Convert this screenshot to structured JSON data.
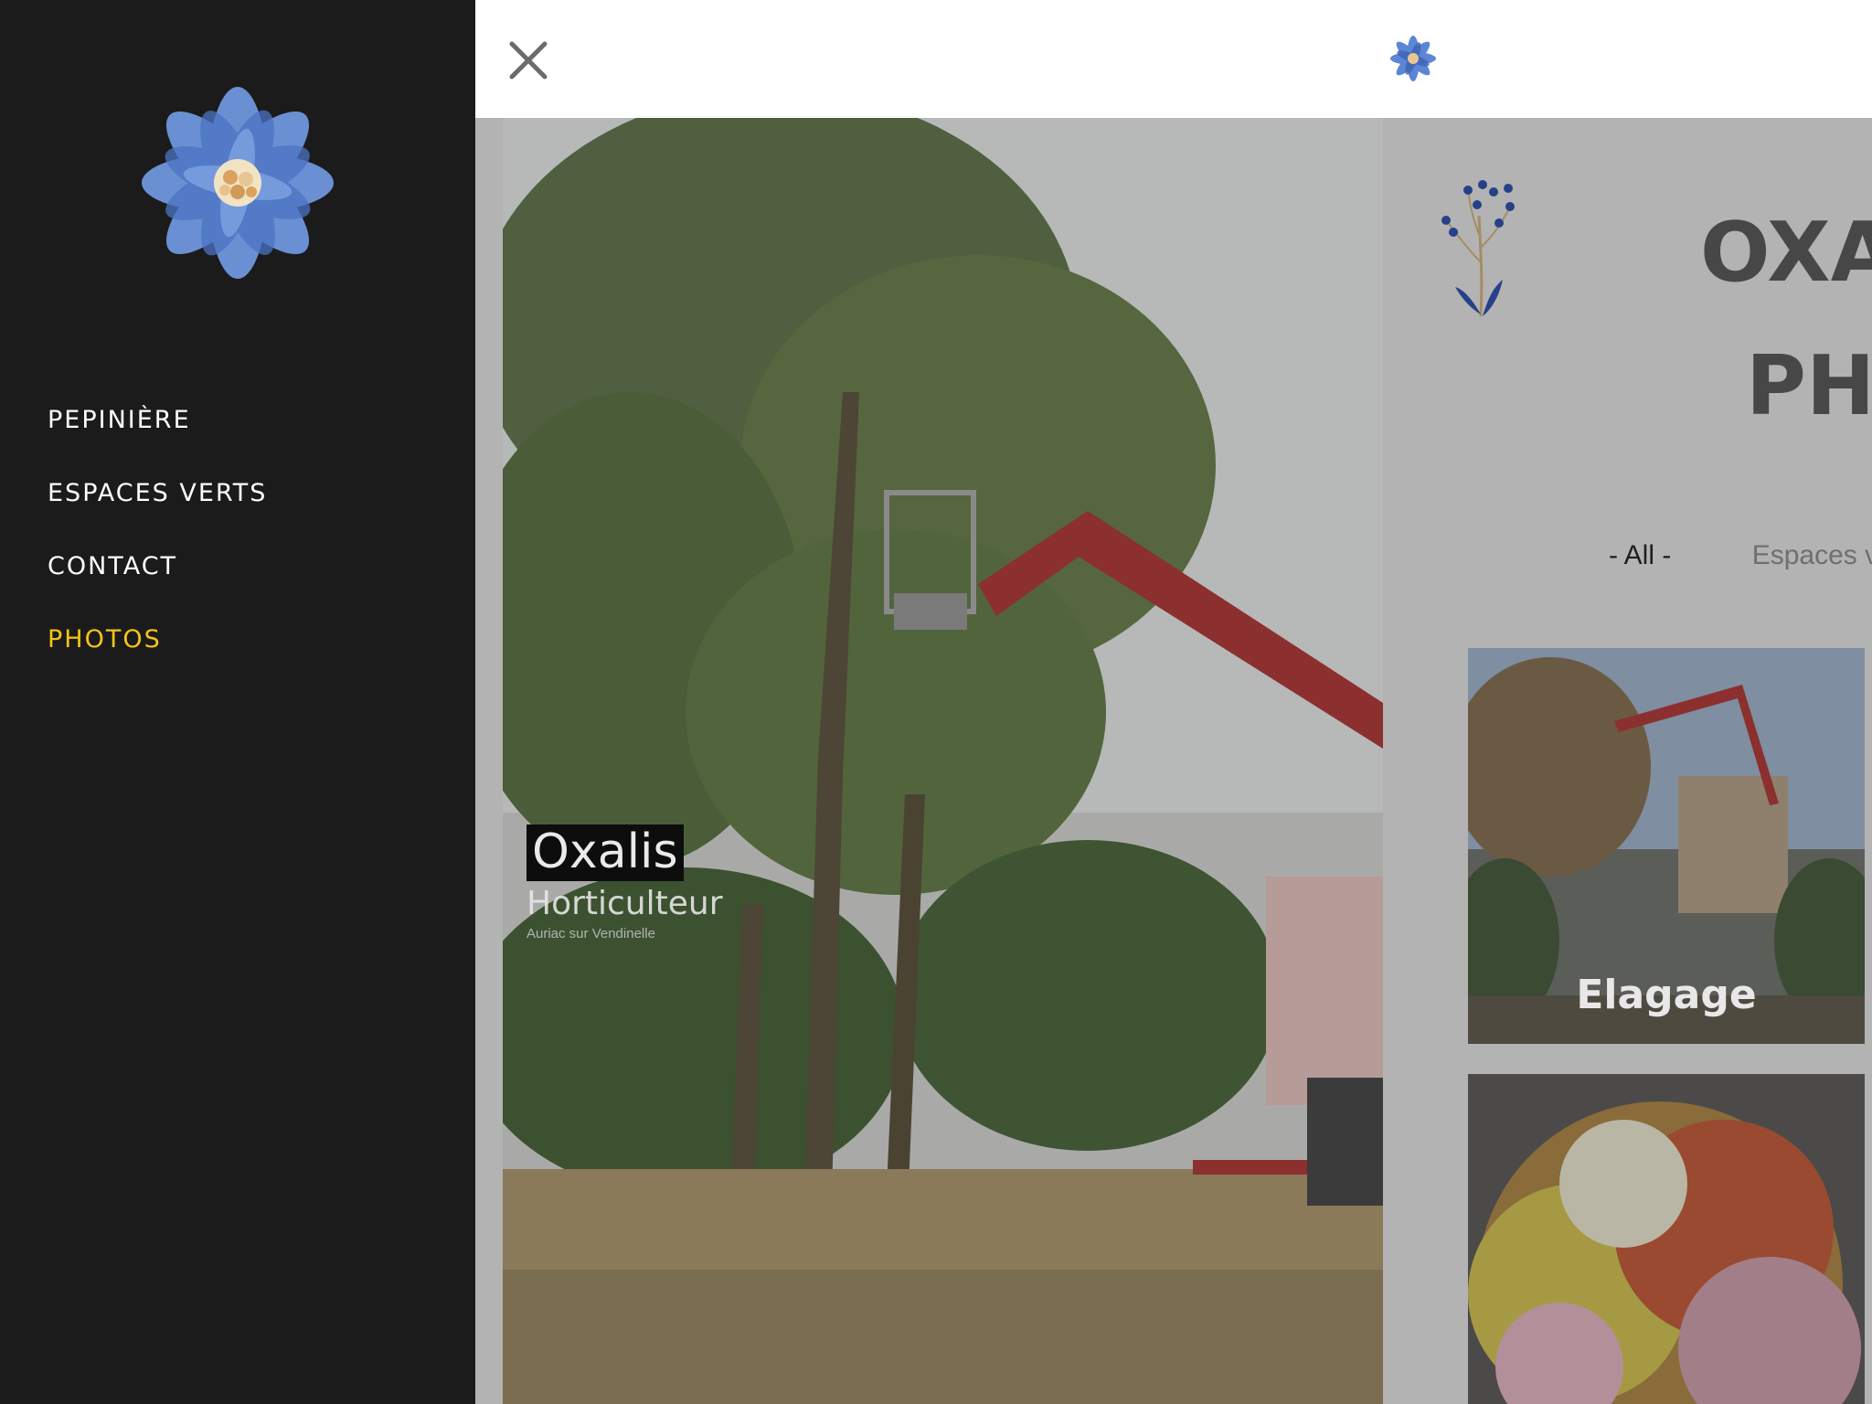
{
  "nav": {
    "items": [
      {
        "label": "PEPINIÈRE",
        "active": false
      },
      {
        "label": "ESPACES VERTS",
        "active": false
      },
      {
        "label": "CONTACT",
        "active": false
      },
      {
        "label": "PHOTOS",
        "active": true
      }
    ],
    "active_color": "#f5c418"
  },
  "topbar": {
    "close_icon": "close-icon",
    "logo_icon": "blue-flower-logo"
  },
  "hero": {
    "title": "Oxalis",
    "subtitle": "Horticulteur",
    "location": "Auriac sur Vendinelle"
  },
  "page": {
    "title_line1": "OXA",
    "title_line2": "PH"
  },
  "filters": {
    "active": "- All -",
    "other": "Espaces v"
  },
  "gallery": [
    {
      "label": "Elagage"
    },
    {
      "label": ""
    }
  ],
  "colors": {
    "drawer_bg": "#1c1b1b",
    "overlay": "#b3b3b3",
    "brand_blue": "#5b86d6"
  }
}
